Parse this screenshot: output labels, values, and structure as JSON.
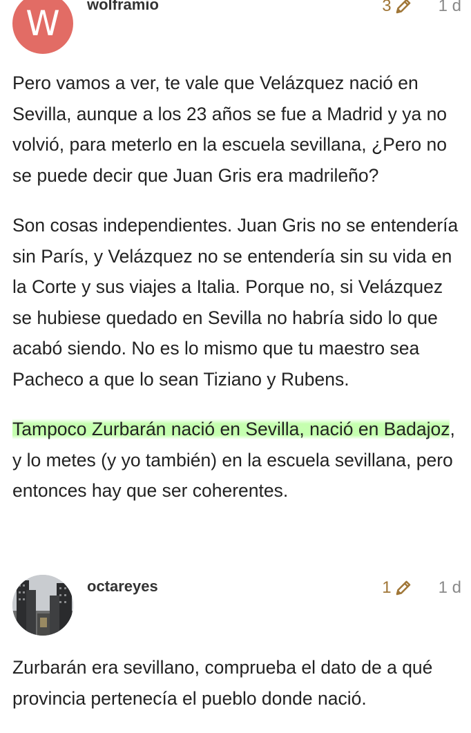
{
  "posts": [
    {
      "username": "wolframio",
      "avatar_letter": "W",
      "avatar_color": "#e26c65",
      "edit_count": "3",
      "age": "1 d",
      "paragraphs": [
        "Pero vamos a ver, te vale que Velázquez nació en Sevilla, aunque a los 23 años se fue a Madrid y ya no volvió, para meterlo en la escuela sevillana, ¿Pero no se puede decir que Juan Gris era madrileño?",
        "Son cosas independientes. Juan Gris no se entendería sin París, y Velázquez no se entendería sin su vida en la Corte y sus viajes a Italia. Porque no, si Velázquez se hubiese quedado en Sevilla no habría sido lo que acabó siendo. No es lo mismo que tu maestro sea Pacheco a que lo sean Tiziano y Rubens."
      ],
      "highlighted_part": "Tampoco Zurbarán nació en Sevilla, nació en Badajoz",
      "rest_part": ", y lo metes (y yo también) en la escuela sevillana, pero entonces hay que ser coherentes."
    },
    {
      "username": "octareyes",
      "edit_count": "1",
      "age": "1 d",
      "paragraphs": [
        "Zurbarán era sevillano, comprueba el dato de a qué provincia pertenecía el pueblo donde nació."
      ]
    }
  ],
  "colors": {
    "edit_count": "#a07637",
    "age": "#8a8a8a",
    "highlight": "#96ff6e"
  },
  "icons": {
    "edit": "pencil-icon"
  }
}
